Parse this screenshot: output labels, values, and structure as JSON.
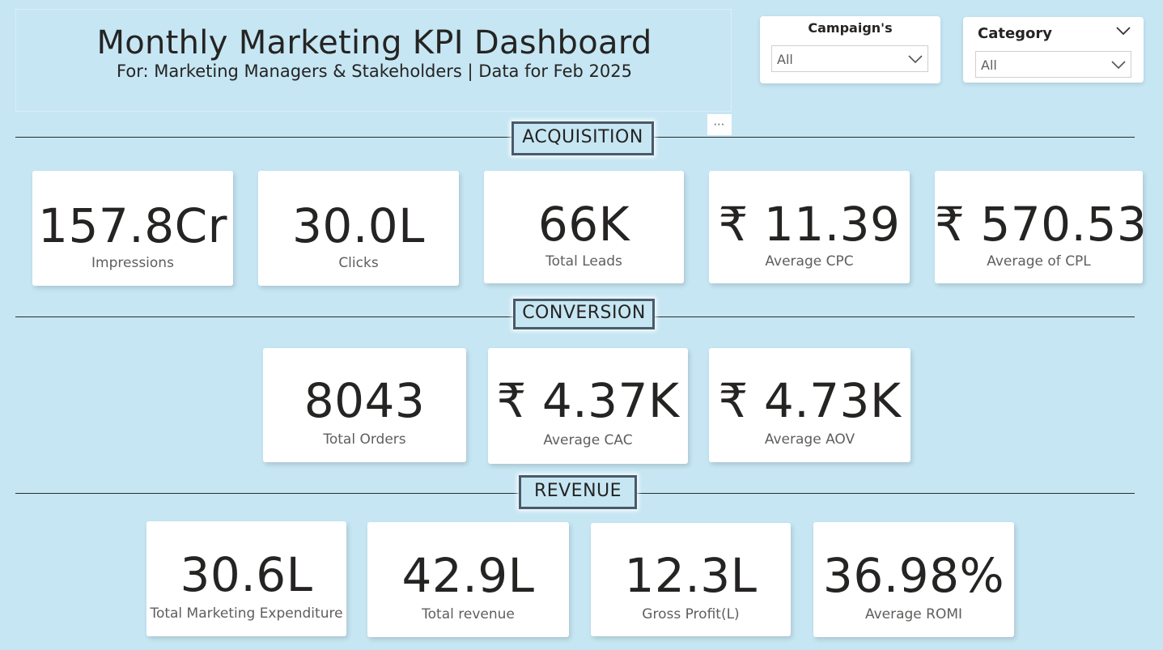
{
  "header": {
    "title": "Monthly Marketing KPI Dashboard",
    "subtitle": "For: Marketing Managers & Stakeholders | Data for Feb 2025",
    "more_options": "⋯"
  },
  "filters": {
    "campaign": {
      "title": "Campaign's",
      "value": "All",
      "icon": "chevron-down-icon"
    },
    "category": {
      "title": "Category",
      "value": "All",
      "icon": "chevron-down-icon"
    }
  },
  "sections": {
    "acquisition": "ACQUISITION",
    "conversion": "CONVERSION",
    "revenue": "REVENUE"
  },
  "kpis": {
    "acquisition": [
      {
        "value": "157.8Cr",
        "label": "Impressions"
      },
      {
        "value": "30.0L",
        "label": "Clicks"
      },
      {
        "value": "66K",
        "label": "Total Leads"
      },
      {
        "value": "₹ 11.39",
        "label": "Average CPC"
      },
      {
        "value": "₹ 570.53",
        "label": "Average of CPL"
      }
    ],
    "conversion": [
      {
        "value": "8043",
        "label": "Total Orders"
      },
      {
        "value": "₹ 4.37K",
        "label": "Average CAC"
      },
      {
        "value": "₹ 4.73K",
        "label": "Average AOV"
      }
    ],
    "revenue": [
      {
        "value": "30.6L",
        "label": "Total Marketing Expenditure"
      },
      {
        "value": "42.9L",
        "label": "Total revenue"
      },
      {
        "value": "12.3L",
        "label": "Gross Profit(L)"
      },
      {
        "value": "36.98%",
        "label": "Average ROMI"
      }
    ]
  },
  "colors": {
    "background": "#c6e6f3",
    "card": "#ffffff",
    "text": "#252423",
    "label": "#605e5c",
    "section_border": "#4a5a6a"
  }
}
